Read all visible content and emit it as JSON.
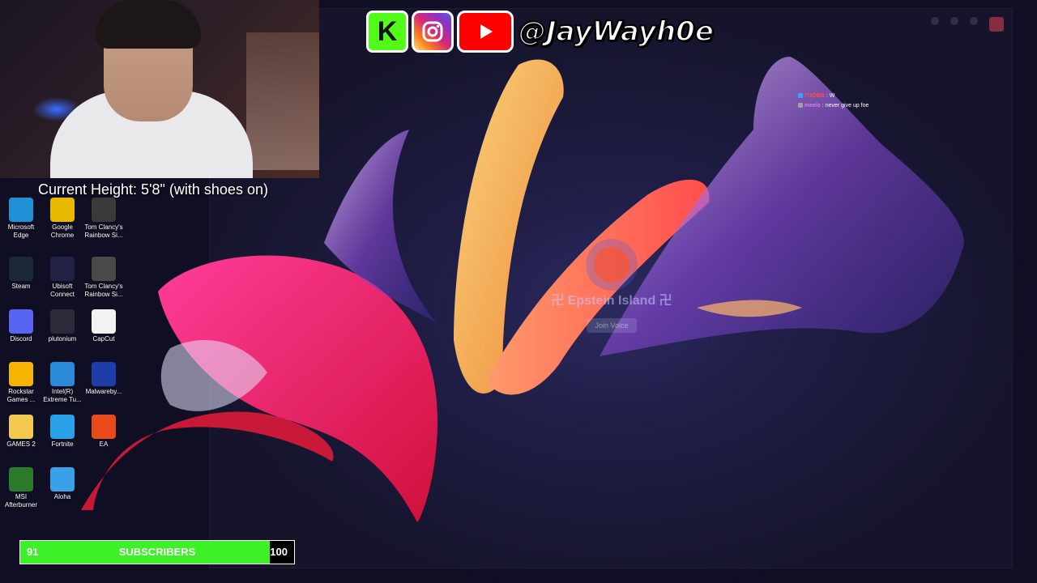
{
  "height_text": "Current Height: 5'8\" (with shoes on)",
  "social": {
    "kick_letter": "K",
    "handle": "@JayWayh0e"
  },
  "server": {
    "name": "卍 Epstein Island 卍",
    "join_label": "Join Voice"
  },
  "chat": [
    {
      "user": "iTzDBB",
      "message": "W",
      "user_color": "#ff4d4d",
      "badge_color": "#3aa0ff"
    },
    {
      "user": "meele",
      "message": "never give up foe",
      "user_color": "#d27cff",
      "badge_color": "#a0a0a0"
    }
  ],
  "desktop_icons": [
    {
      "label": "Microsoft Edge",
      "icon": "edge-icon",
      "color": "#1f8fd6"
    },
    {
      "label": "Google Chrome",
      "icon": "chrome-icon",
      "color": "#e8b800"
    },
    {
      "label": "Tom Clancy's Rainbow Si...",
      "icon": "rainbow-six-icon",
      "color": "#3a3a3a"
    },
    {
      "label": "Steam",
      "icon": "steam-icon",
      "color": "#1b2838"
    },
    {
      "label": "Ubisoft Connect",
      "icon": "ubisoft-icon",
      "color": "#222244"
    },
    {
      "label": "Tom Clancy's Rainbow Si...",
      "icon": "rainbow-six-icon",
      "color": "#4a4a4a"
    },
    {
      "label": "Discord",
      "icon": "discord-icon",
      "color": "#5865f2"
    },
    {
      "label": "plutonium",
      "icon": "plutonium-icon",
      "color": "#2a2a3a"
    },
    {
      "label": "CapCut",
      "icon": "capcut-icon",
      "color": "#f2f2f2"
    },
    {
      "label": "Rockstar Games ...",
      "icon": "rockstar-icon",
      "color": "#f5b400"
    },
    {
      "label": "Intel(R) Extreme Tu...",
      "icon": "intel-icon",
      "color": "#2a8ad8"
    },
    {
      "label": "Malwareby...",
      "icon": "malwarebytes-icon",
      "color": "#1d3ea8"
    },
    {
      "label": "GAMES 2",
      "icon": "folder-icon",
      "color": "#f3c94f"
    },
    {
      "label": "Fortnite",
      "icon": "fortnite-icon",
      "color": "#2aa0e8"
    },
    {
      "label": "EA",
      "icon": "ea-icon",
      "color": "#e84a1a"
    },
    {
      "label": "MSI Afterburner",
      "icon": "msi-afterburner-icon",
      "color": "#2b7a2b"
    },
    {
      "label": "Aloha",
      "icon": "aloha-icon",
      "color": "#3aa0e8"
    }
  ],
  "subscribers": {
    "current": "91",
    "label": "SUBSCRIBERS",
    "goal": "100",
    "progress_fraction": 0.91,
    "bar_color": "#3df028"
  }
}
